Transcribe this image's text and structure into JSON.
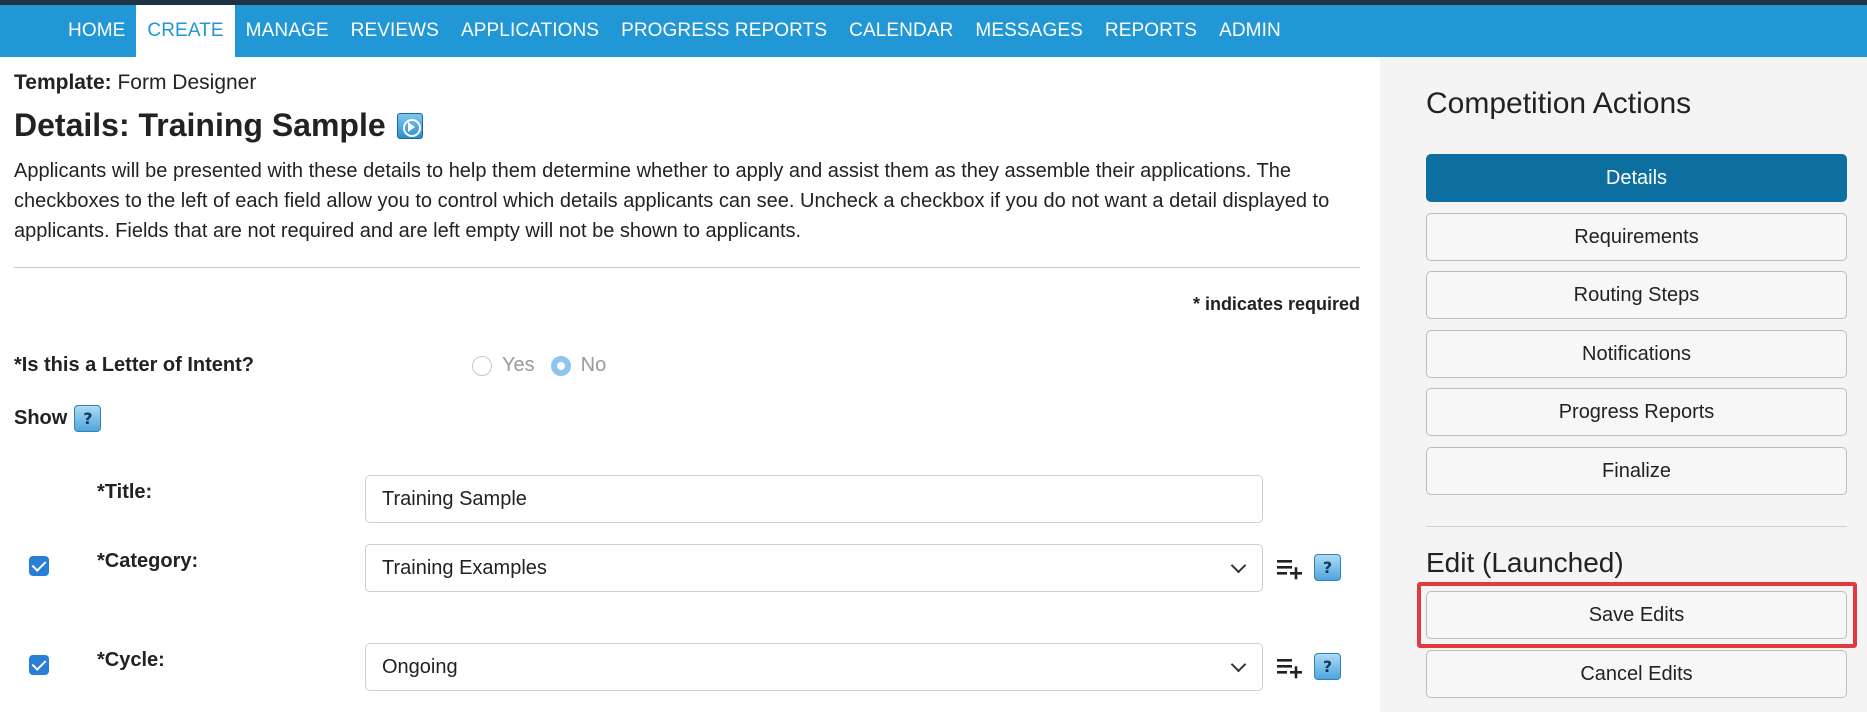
{
  "nav": {
    "items": [
      {
        "label": "HOME"
      },
      {
        "label": "CREATE",
        "active": true
      },
      {
        "label": "MANAGE"
      },
      {
        "label": "REVIEWS"
      },
      {
        "label": "APPLICATIONS"
      },
      {
        "label": "PROGRESS REPORTS"
      },
      {
        "label": "CALENDAR"
      },
      {
        "label": "MESSAGES"
      },
      {
        "label": "REPORTS"
      },
      {
        "label": "ADMIN"
      }
    ]
  },
  "header": {
    "template_label": "Template:",
    "template_value": "Form Designer",
    "title": "Details: Training Sample"
  },
  "description": "Applicants will be presented with these details to help them determine whether to apply and assist them as they assemble their applications. The checkboxes to the left of each field allow you to control which details applicants can see. Uncheck a checkbox if you do not want a detail displayed to applicants. Fields that are not required and are left empty will not be shown to applicants.",
  "required_note": "* indicates required",
  "loi": {
    "label": "*Is this a Letter of Intent?",
    "options": [
      "Yes",
      "No"
    ],
    "selected": "No"
  },
  "show": {
    "label": "Show",
    "help": "?"
  },
  "fields": {
    "title": {
      "label": "*Title:",
      "value": "Training Sample"
    },
    "category": {
      "label": "*Category:",
      "value": "Training Examples",
      "checked": true
    },
    "cycle": {
      "label": "*Cycle:",
      "value": "Ongoing",
      "checked": true
    }
  },
  "help_glyph": "?",
  "sidebar": {
    "title": "Competition Actions",
    "buttons": [
      "Details",
      "Requirements",
      "Routing Steps",
      "Notifications",
      "Progress Reports",
      "Finalize"
    ],
    "edit_title": "Edit (Launched)",
    "save_label": "Save Edits",
    "cancel_label": "Cancel Edits"
  },
  "colors": {
    "navbar": "#2197d6",
    "primary_button": "#0d6fa0",
    "highlight": "#e0393e",
    "checkbox": "#2a7fd4"
  },
  "icons": [
    "video-help-icon",
    "help-icon",
    "list-add-icon",
    "chevron-down-icon",
    "checkbox-icon"
  ]
}
